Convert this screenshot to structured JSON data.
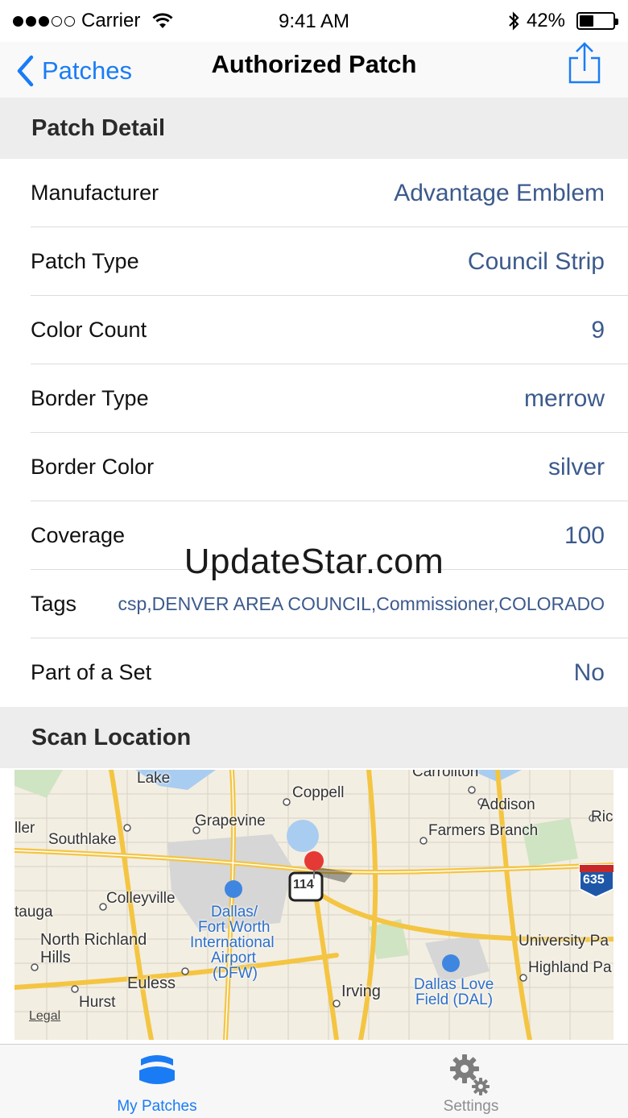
{
  "status_bar": {
    "carrier": "Carrier",
    "time": "9:41 AM",
    "battery": "42%",
    "battery_level": 0.42
  },
  "nav": {
    "back_label": "Patches",
    "title": "Authorized Patch",
    "share_icon": "share-icon"
  },
  "detail": {
    "header": "Patch Detail",
    "rows": [
      {
        "label": "Manufacturer",
        "value": "Advantage Emblem"
      },
      {
        "label": "Patch Type",
        "value": "Council Strip"
      },
      {
        "label": "Color Count",
        "value": "9"
      },
      {
        "label": "Border Type",
        "value": "merrow"
      },
      {
        "label": "Border Color",
        "value": "silver"
      },
      {
        "label": "Coverage",
        "value": "100"
      },
      {
        "label": "Tags",
        "value": "csp,DENVER AREA COUNCIL,Commissioner,COLORADO"
      },
      {
        "label": "Part of a Set",
        "value": "No"
      }
    ]
  },
  "scan_location": {
    "header": "Scan Location",
    "legal": "Legal",
    "places": {
      "lake": "Lake",
      "coppell": "Coppell",
      "carrollton": "Carrollton",
      "addison": "Addison",
      "ric": "Ric",
      "grapevine": "Grapevine",
      "farmers_branch": "Farmers Branch",
      "ller": "ller",
      "southlake": "Southlake",
      "colleyville": "Colleyville",
      "tauga": "tauga",
      "dfw_1": "Dallas/",
      "dfw_2": "Fort Worth",
      "dfw_3": "International",
      "dfw_4": "Airport",
      "dfw_5": "(DFW)",
      "north_richland_1": "North Richland",
      "north_richland_2": "Hills",
      "university_park": "University Pa",
      "highland_park": "Highland Pa",
      "euless": "Euless",
      "irving": "Irving",
      "hurst": "Hurst",
      "dallas_love_1": "Dallas Love",
      "dallas_love_2": "Field (DAL)",
      "highway_114": "114",
      "highway_635": "635"
    }
  },
  "tabs": [
    {
      "label": "My Patches",
      "icon": "patch-icon",
      "active": true
    },
    {
      "label": "Settings",
      "icon": "gear-icon",
      "active": false
    }
  ],
  "watermark": "UpdateStar.com"
}
